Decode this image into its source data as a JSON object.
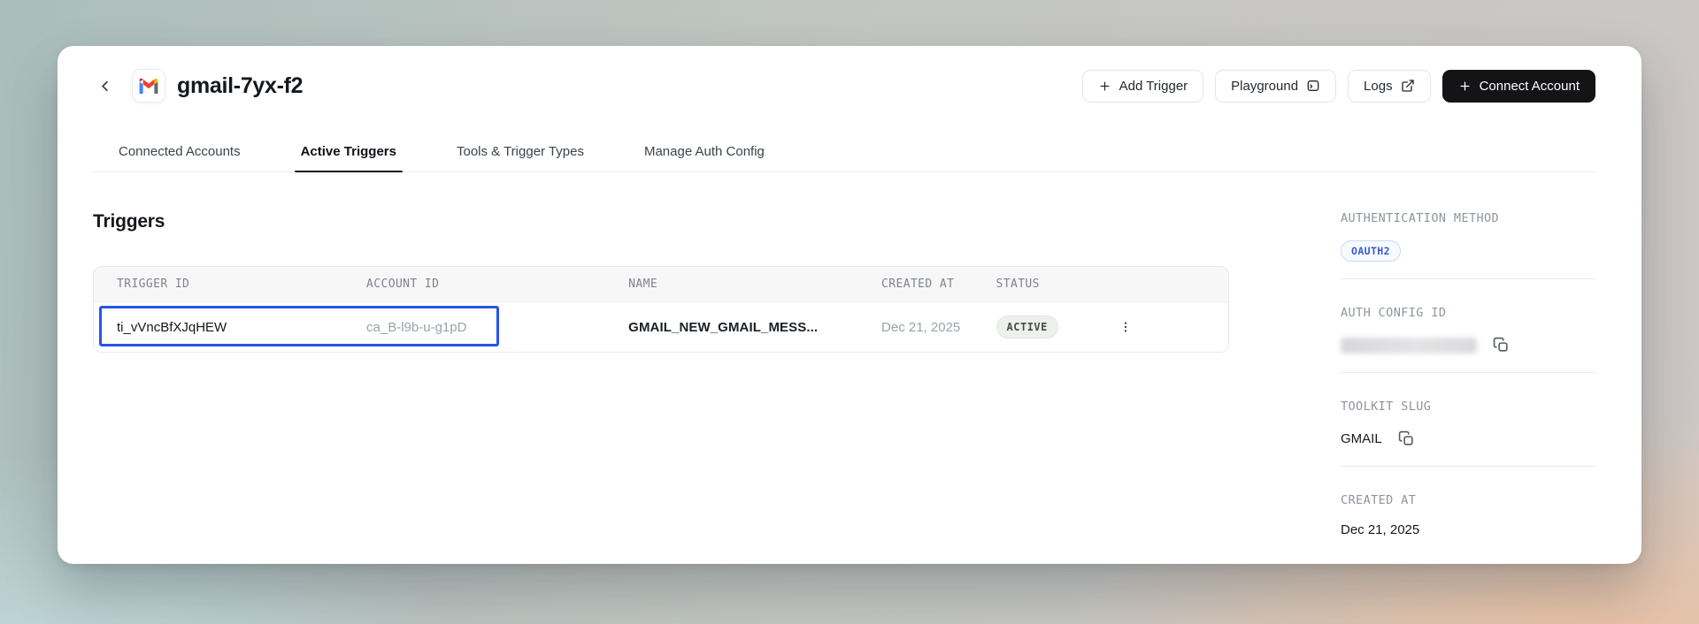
{
  "header": {
    "title": "gmail-7yx-f2",
    "buttons": {
      "add_trigger": "Add Trigger",
      "playground": "Playground",
      "logs": "Logs",
      "connect_account": "Connect Account"
    }
  },
  "tabs": [
    {
      "label": "Connected Accounts",
      "active": false
    },
    {
      "label": "Active Triggers",
      "active": true
    },
    {
      "label": "Tools & Trigger Types",
      "active": false
    },
    {
      "label": "Manage Auth Config",
      "active": false
    }
  ],
  "main": {
    "section_title": "Triggers",
    "table": {
      "columns": [
        "TRIGGER ID",
        "ACCOUNT ID",
        "NAME",
        "CREATED AT",
        "STATUS"
      ],
      "rows": [
        {
          "trigger_id": "ti_vVncBfXJqHEW",
          "account_id": "ca_B-l9b-u-g1pD",
          "name": "GMAIL_NEW_GMAIL_MESS...",
          "created_at": "Dec 21, 2025",
          "status": "ACTIVE"
        }
      ]
    }
  },
  "sidebar": {
    "auth_method": {
      "label": "AUTHENTICATION METHOD",
      "value": "OAUTH2"
    },
    "auth_config": {
      "label": "AUTH CONFIG ID",
      "value_redacted": true
    },
    "toolkit_slug": {
      "label": "TOOLKIT SLUG",
      "value": "GMAIL"
    },
    "created_at": {
      "label": "CREATED AT",
      "value": "Dec 21, 2025"
    }
  },
  "icons": {
    "gmail_logo": "gmail-m-logo",
    "playground": "terminal-window-icon",
    "logs": "external-link-icon",
    "copy": "copy-icon",
    "row_menu": "kebab-menu-icon"
  },
  "colors": {
    "selection_blue": "#2456e8",
    "oauth_badge_text": "#3a5ad6",
    "status_badge_text": "#3f5149",
    "dark_button": "#141417",
    "bg_teal": "#abbebb",
    "bg_peach": "#f3c09a"
  }
}
